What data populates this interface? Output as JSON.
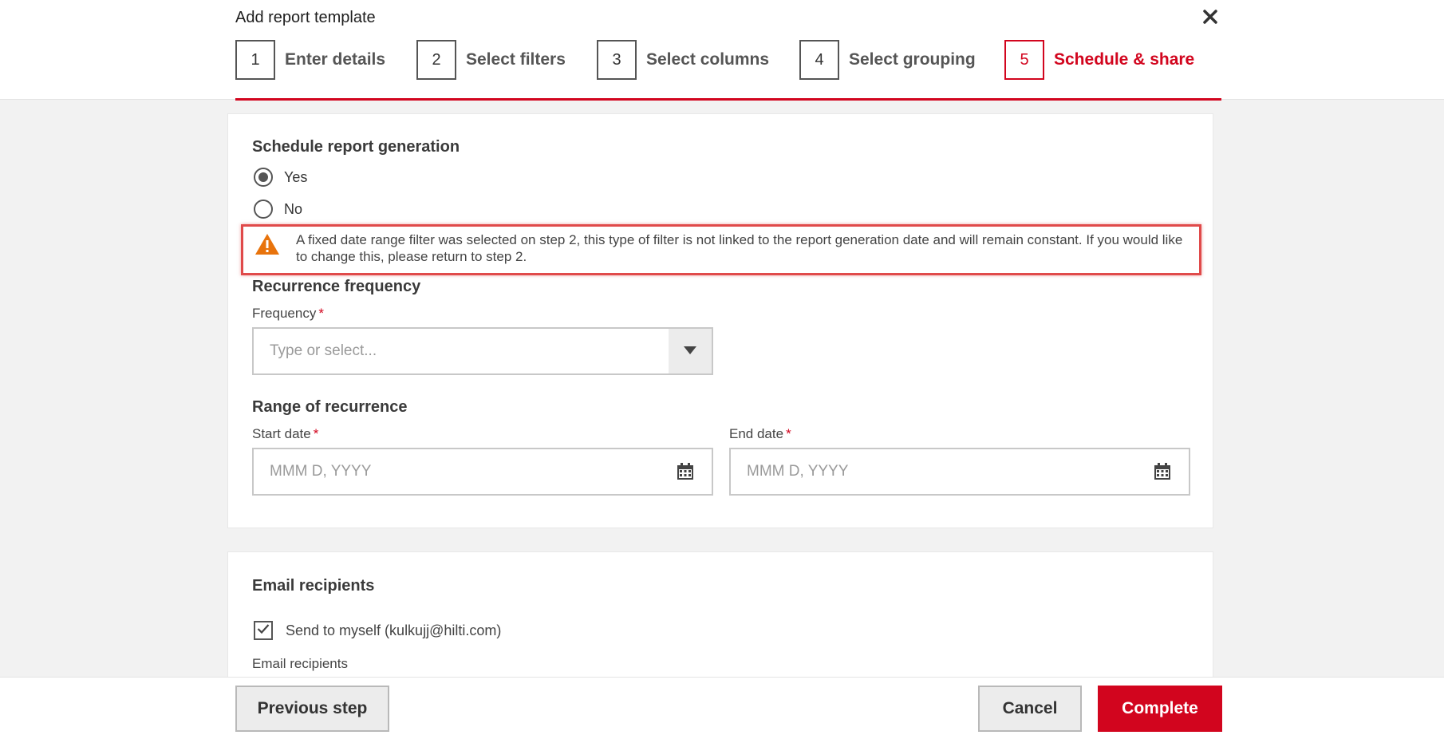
{
  "dialog": {
    "title": "Add report template",
    "close_icon": "close-icon"
  },
  "steps": [
    {
      "number": "1",
      "label": "Enter details"
    },
    {
      "number": "2",
      "label": "Select filters"
    },
    {
      "number": "3",
      "label": "Select columns"
    },
    {
      "number": "4",
      "label": "Select grouping"
    },
    {
      "number": "5",
      "label": "Schedule & share"
    }
  ],
  "active_step": "5",
  "schedule": {
    "title": "Schedule report generation",
    "options": [
      {
        "label": "Yes",
        "selected": true
      },
      {
        "label": "No",
        "selected": false
      }
    ],
    "warning": "A fixed date range filter was selected on step 2, this type of filter is not linked to the report generation date and will remain constant. If you would like to change this, please return to step 2.",
    "warning_icon": "warning-triangle-icon"
  },
  "recurrence": {
    "title": "Recurrence frequency",
    "frequency_label": "Frequency",
    "required_mark": "*",
    "frequency_placeholder": "Type or select...",
    "range_title": "Range of recurrence",
    "start_label": "Start date",
    "end_label": "End date",
    "date_placeholder": "MMM D, YYYY"
  },
  "email": {
    "title": "Email recipients",
    "send_to_myself": "Send to myself (kulkujj@hilti.com)",
    "send_to_myself_checked": true,
    "recipients_label": "Email recipients"
  },
  "footer": {
    "previous": "Previous step",
    "cancel": "Cancel",
    "complete": "Complete"
  },
  "colors": {
    "accent": "#d2051e",
    "warning": "#e8730c",
    "highlight_border": "#e04a4a"
  }
}
